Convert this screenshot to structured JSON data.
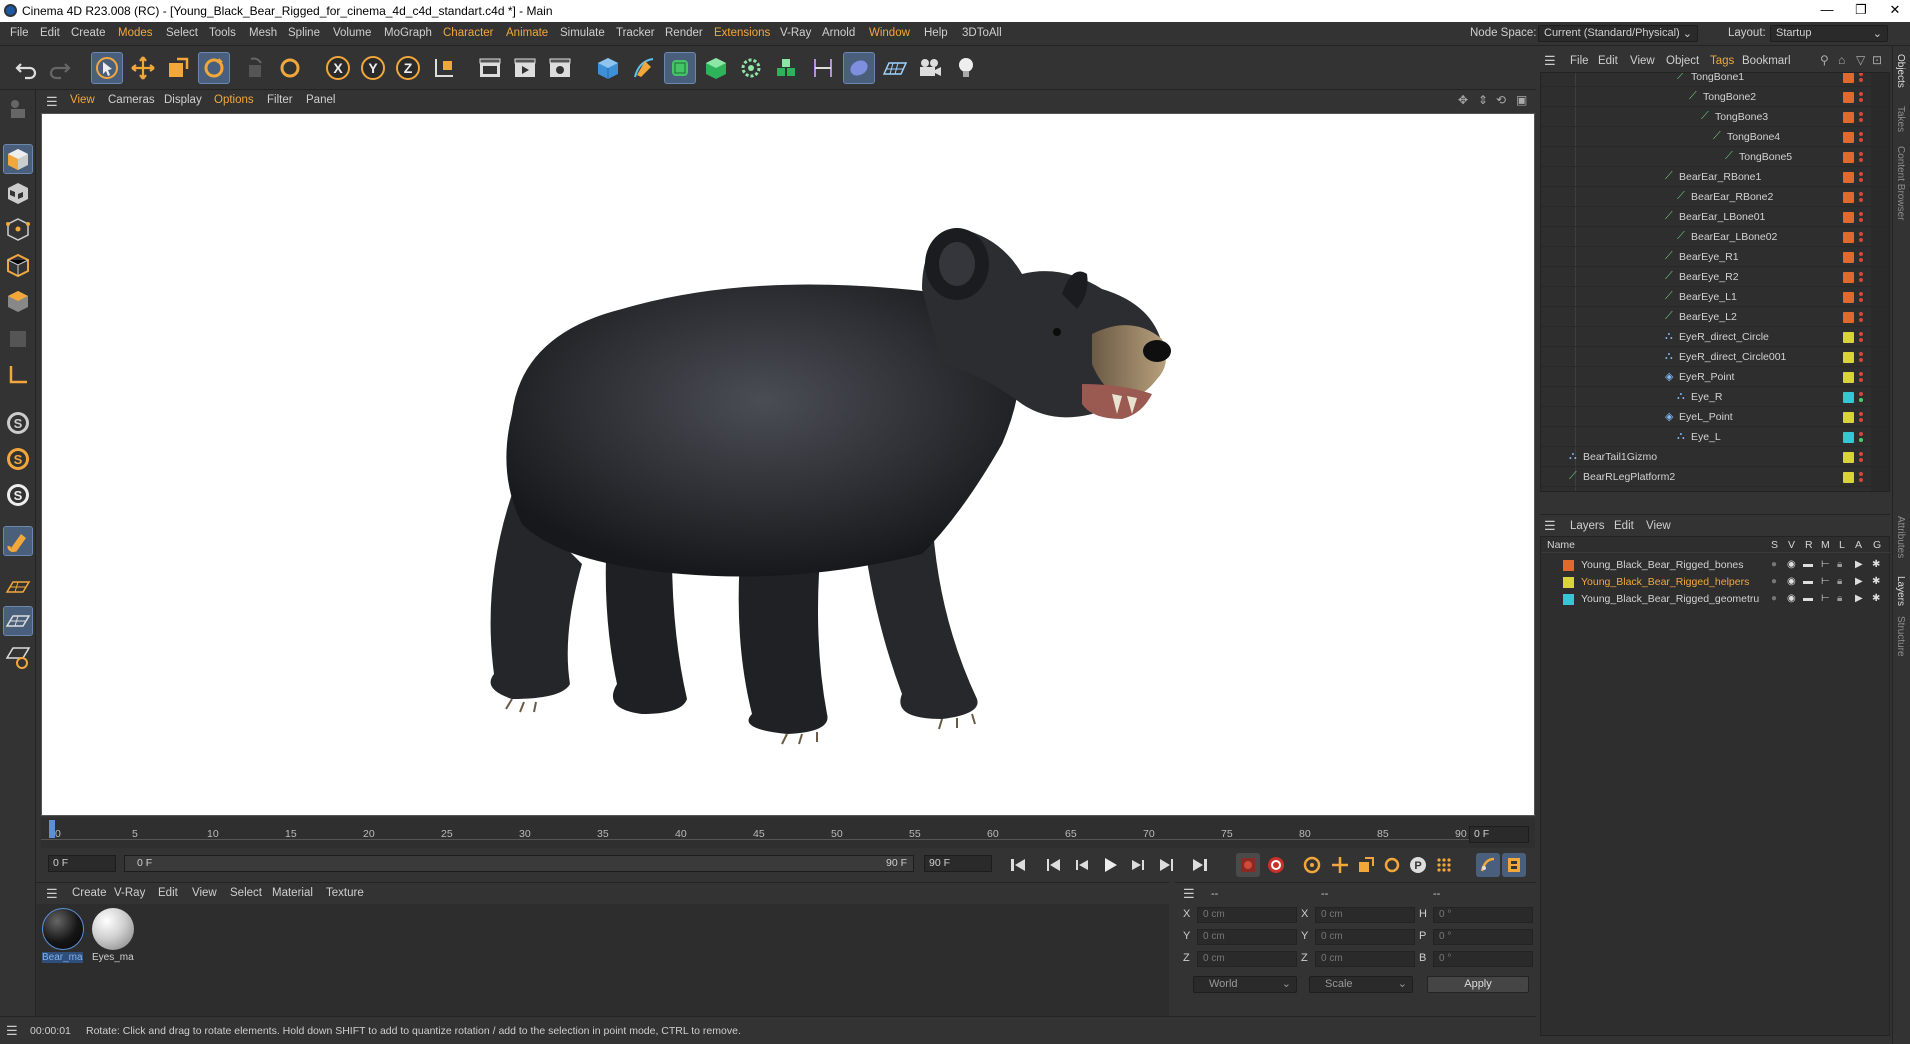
{
  "window": {
    "title": "Cinema 4D R23.008 (RC) - [Young_Black_Bear_Rigged_for_cinema_4d_c4d_standart.c4d *] - Main",
    "controls": [
      "—",
      "❐",
      "✕"
    ]
  },
  "menubar": {
    "items": [
      "File",
      "Edit",
      "Create",
      "Modes",
      "Select",
      "Tools",
      "Mesh",
      "Spline",
      "Volume",
      "MoGraph",
      "Character",
      "Animate",
      "Simulate",
      "Tracker",
      "Render",
      "Extensions",
      "V-Ray",
      "Arnold",
      "Window",
      "Help",
      "3DToAll"
    ],
    "highlighted": [
      "Modes",
      "Character",
      "Animate",
      "Extensions",
      "Window"
    ],
    "node_space_label": "Node Space:",
    "node_space_value": "Current (Standard/Physical)",
    "layout_label": "Layout:",
    "layout_value": "Startup"
  },
  "viewport": {
    "menu": [
      "View",
      "Cameras",
      "Display",
      "Options",
      "Filter",
      "Panel"
    ],
    "highlighted": [
      "View",
      "Options"
    ]
  },
  "timeline": {
    "ticks": [
      "0",
      "5",
      "10",
      "15",
      "20",
      "25",
      "30",
      "35",
      "40",
      "45",
      "50",
      "55",
      "60",
      "65",
      "70",
      "75",
      "80",
      "85",
      "90"
    ],
    "frame_right": "0 F",
    "current_frame": "0 F",
    "range_start": "0 F",
    "range_end": "90 F",
    "max_frame": "90 F"
  },
  "material_manager": {
    "menu": [
      "Create",
      "V-Ray",
      "Edit",
      "View",
      "Select",
      "Material",
      "Texture"
    ],
    "materials": [
      {
        "name": "Bear_ma",
        "selected": true
      },
      {
        "name": "Eyes_ma",
        "selected": false
      }
    ]
  },
  "coordinates": {
    "header": [
      "--",
      "--",
      "--"
    ],
    "rows": [
      {
        "a": "X",
        "av": "0 cm",
        "b": "X",
        "bv": "0 cm",
        "c": "H",
        "cv": "0 °"
      },
      {
        "a": "Y",
        "av": "0 cm",
        "b": "Y",
        "bv": "0 cm",
        "c": "P",
        "cv": "0 °"
      },
      {
        "a": "Z",
        "av": "0 cm",
        "b": "Z",
        "bv": "0 cm",
        "c": "B",
        "cv": "0 °"
      }
    ],
    "mode": "World",
    "transform": "Scale",
    "apply": "Apply"
  },
  "status": {
    "time": "00:00:01",
    "message": "Rotate: Click and drag to rotate elements. Hold down SHIFT to add to quantize rotation / add to the selection in point mode, CTRL to remove."
  },
  "object_manager": {
    "menu": [
      "File",
      "Edit",
      "View",
      "Object",
      "Tags",
      "Bookmarl"
    ],
    "highlighted": [
      "Tags"
    ],
    "objects": [
      {
        "name": "TongBone1",
        "indent": 10,
        "icon": "bone",
        "tag": "#e06a2c"
      },
      {
        "name": "TongBone2",
        "indent": 11,
        "icon": "bone",
        "tag": "#e06a2c"
      },
      {
        "name": "TongBone3",
        "indent": 12,
        "icon": "bone",
        "tag": "#e06a2c"
      },
      {
        "name": "TongBone4",
        "indent": 13,
        "icon": "bone",
        "tag": "#e06a2c"
      },
      {
        "name": "TongBone5",
        "indent": 14,
        "icon": "bone",
        "tag": "#e06a2c"
      },
      {
        "name": "BearEar_RBone1",
        "indent": 9,
        "icon": "bone",
        "tag": "#e06a2c"
      },
      {
        "name": "BearEar_RBone2",
        "indent": 10,
        "icon": "bone",
        "tag": "#e06a2c"
      },
      {
        "name": "BearEar_LBone01",
        "indent": 9,
        "icon": "bone",
        "tag": "#e06a2c"
      },
      {
        "name": "BearEar_LBone02",
        "indent": 10,
        "icon": "bone",
        "tag": "#e06a2c"
      },
      {
        "name": "BearEye_R1",
        "indent": 9,
        "icon": "bone",
        "tag": "#e06a2c"
      },
      {
        "name": "BearEye_R2",
        "indent": 9,
        "icon": "bone",
        "tag": "#e06a2c"
      },
      {
        "name": "BearEye_L1",
        "indent": 9,
        "icon": "bone",
        "tag": "#e06a2c"
      },
      {
        "name": "BearEye_L2",
        "indent": 9,
        "icon": "bone",
        "tag": "#e06a2c"
      },
      {
        "name": "EyeR_direct_Circle",
        "indent": 9,
        "icon": "null",
        "tag": "#d8d43a"
      },
      {
        "name": "EyeR_direct_Circle001",
        "indent": 9,
        "icon": "null",
        "tag": "#d8d43a"
      },
      {
        "name": "EyeR_Point",
        "indent": 9,
        "icon": "point",
        "tag": "#d8d43a"
      },
      {
        "name": "Eye_R",
        "indent": 10,
        "icon": "null",
        "tag": "#35c7d6"
      },
      {
        "name": "EyeL_Point",
        "indent": 9,
        "icon": "point",
        "tag": "#d8d43a"
      },
      {
        "name": "Eye_L",
        "indent": 10,
        "icon": "null",
        "tag": "#35c7d6"
      },
      {
        "name": "BearTail1Gizmo",
        "indent": 1,
        "icon": "null",
        "tag": "#d8d43a"
      },
      {
        "name": "BearRLegPlatform2",
        "indent": 1,
        "icon": "bone",
        "tag": "#d8d43a"
      }
    ]
  },
  "layer_manager": {
    "menu": [
      "Layers",
      "Edit",
      "View"
    ],
    "columns": {
      "name": "Name",
      "flags": [
        "S",
        "V",
        "R",
        "M",
        "L",
        "A",
        "G"
      ]
    },
    "layers": [
      {
        "name": "Young_Black_Bear_Rigged_bones",
        "color": "#e06a2c",
        "highlight": false
      },
      {
        "name": "Young_Black_Bear_Rigged_helpers",
        "color": "#d8d43a",
        "highlight": true
      },
      {
        "name": "Young_Black_Bear_Rigged_geometru",
        "color": "#35c7d6",
        "highlight": false
      }
    ]
  },
  "side_tabs": [
    "Objects",
    "Takes",
    "Content Browser",
    "Attributes",
    "Layers",
    "Structure"
  ]
}
